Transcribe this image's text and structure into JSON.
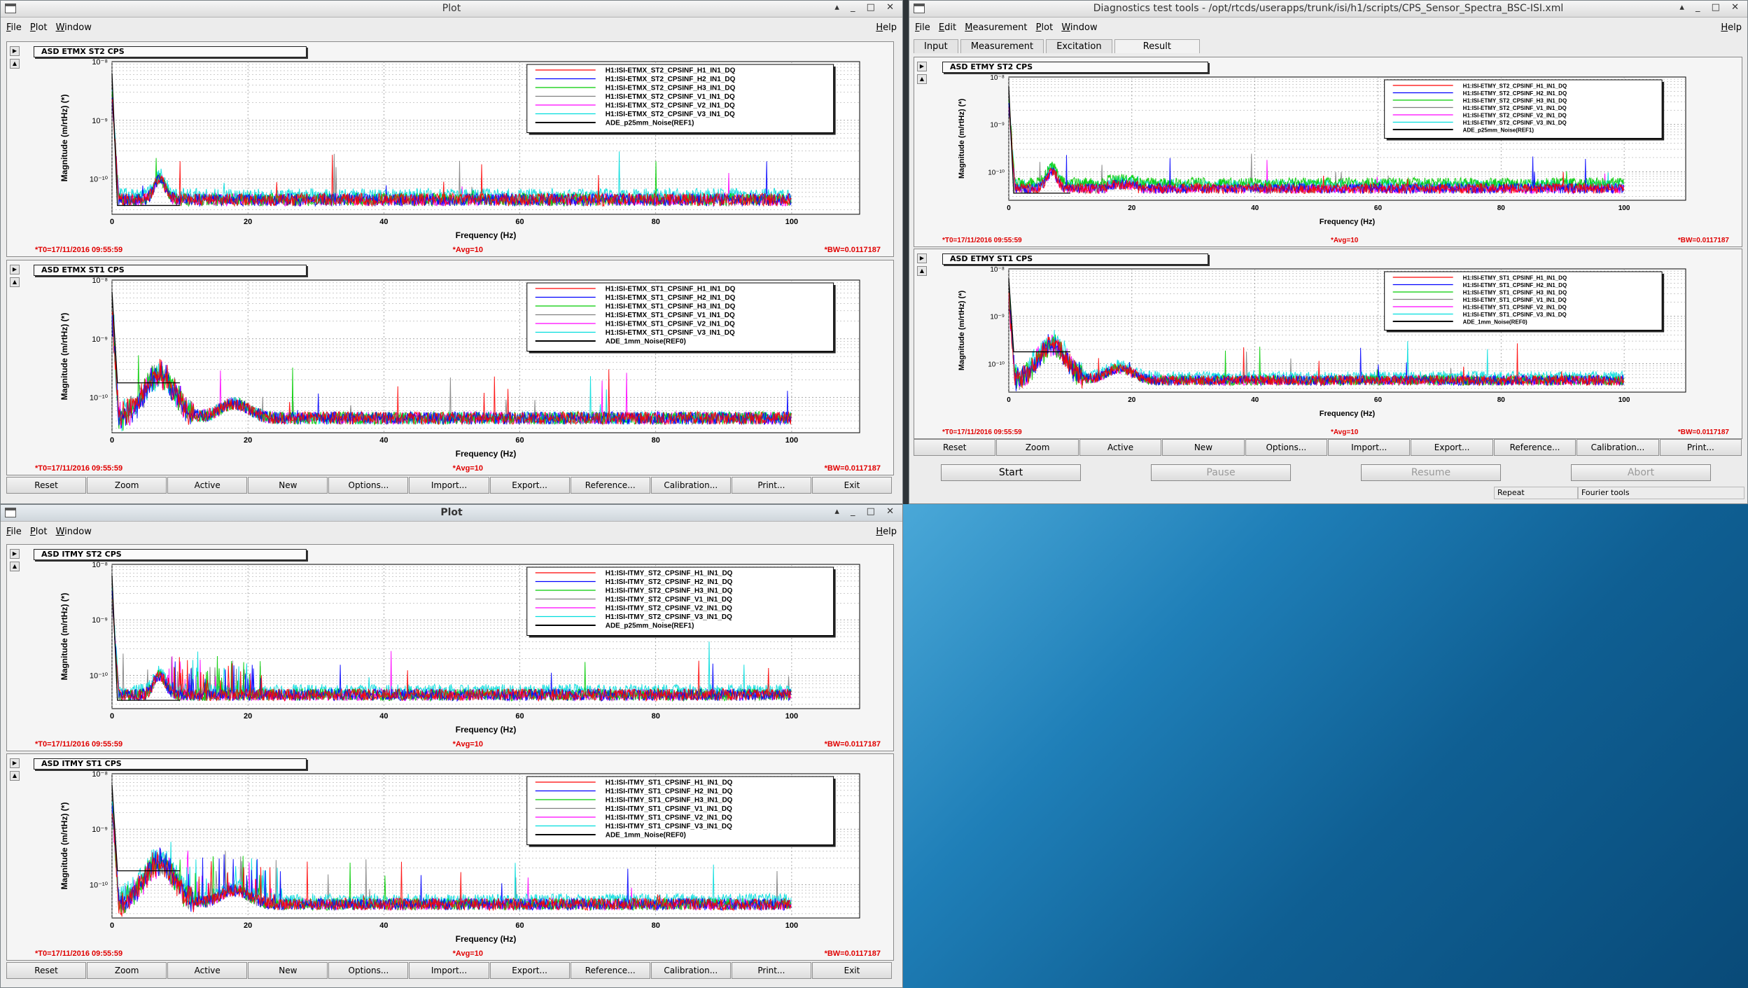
{
  "windows": {
    "plot_top": {
      "title": "Plot",
      "menu": [
        "File",
        "Plot",
        "Window"
      ],
      "help": "Help",
      "pads": [
        {
          "title": "ASD ETMX ST2 CPS",
          "legend": [
            "H1:ISI-ETMX_ST2_CPSINF_H1_IN1_DQ",
            "H1:ISI-ETMX_ST2_CPSINF_H2_IN1_DQ",
            "H1:ISI-ETMX_ST2_CPSINF_H3_IN1_DQ",
            "H1:ISI-ETMX_ST2_CPSINF_V1_IN1_DQ",
            "H1:ISI-ETMX_ST2_CPSINF_V2_IN1_DQ",
            "H1:ISI-ETMX_ST2_CPSINF_V3_IN1_DQ",
            "ADE_p25mm_Noise(REF1)"
          ],
          "shape": "st2"
        },
        {
          "title": "ASD ETMX ST1 CPS",
          "legend": [
            "H1:ISI-ETMX_ST1_CPSINF_H1_IN1_DQ",
            "H1:ISI-ETMX_ST1_CPSINF_H2_IN1_DQ",
            "H1:ISI-ETMX_ST1_CPSINF_H3_IN1_DQ",
            "H1:ISI-ETMX_ST1_CPSINF_V1_IN1_DQ",
            "H1:ISI-ETMX_ST1_CPSINF_V2_IN1_DQ",
            "H1:ISI-ETMX_ST1_CPSINF_V3_IN1_DQ",
            "ADE_1mm_Noise(REF0)"
          ],
          "shape": "st1"
        }
      ]
    },
    "plot_bottom": {
      "title": "Plot",
      "menu": [
        "File",
        "Plot",
        "Window"
      ],
      "help": "Help",
      "pads": [
        {
          "title": "ASD ITMY ST2 CPS",
          "legend": [
            "H1:ISI-ITMY_ST2_CPSINF_H1_IN1_DQ",
            "H1:ISI-ITMY_ST2_CPSINF_H2_IN1_DQ",
            "H1:ISI-ITMY_ST2_CPSINF_H3_IN1_DQ",
            "H1:ISI-ITMY_ST2_CPSINF_V1_IN1_DQ",
            "H1:ISI-ITMY_ST2_CPSINF_V2_IN1_DQ",
            "H1:ISI-ITMY_ST2_CPSINF_V3_IN1_DQ",
            "ADE_p25mm_Noise(REF1)"
          ],
          "shape": "st2b"
        },
        {
          "title": "ASD ITMY ST1 CPS",
          "legend": [
            "H1:ISI-ITMY_ST1_CPSINF_H1_IN1_DQ",
            "H1:ISI-ITMY_ST1_CPSINF_H2_IN1_DQ",
            "H1:ISI-ITMY_ST1_CPSINF_H3_IN1_DQ",
            "H1:ISI-ITMY_ST1_CPSINF_V1_IN1_DQ",
            "H1:ISI-ITMY_ST1_CPSINF_V2_IN1_DQ",
            "H1:ISI-ITMY_ST1_CPSINF_V3_IN1_DQ",
            "ADE_1mm_Noise(REF0)"
          ],
          "shape": "st1b"
        }
      ]
    },
    "dtt": {
      "title": "Diagnostics test tools - /opt/rtcds/userapps/trunk/isi/h1/scripts/CPS_Sensor_Spectra_BSC-ISI.xml",
      "menu": [
        "File",
        "Edit",
        "Measurement",
        "Plot",
        "Window"
      ],
      "help": "Help",
      "tabs": [
        "Input",
        "Measurement",
        "Excitation",
        "Result"
      ],
      "pads": [
        {
          "title": "ASD ETMY ST2 CPS",
          "legend": [
            "H1:ISI-ETMY_ST2_CPSINF_H1_IN1_DQ",
            "H1:ISI-ETMY_ST2_CPSINF_H2_IN1_DQ",
            "H1:ISI-ETMY_ST2_CPSINF_H3_IN1_DQ",
            "H1:ISI-ETMY_ST2_CPSINF_V1_IN1_DQ",
            "H1:ISI-ETMY_ST2_CPSINF_V2_IN1_DQ",
            "H1:ISI-ETMY_ST2_CPSINF_V3_IN1_DQ",
            "ADE_p25mm_Noise(REF1)"
          ],
          "shape": "st2c"
        },
        {
          "title": "ASD ETMY ST1 CPS",
          "legend": [
            "H1:ISI-ETMY_ST1_CPSINF_H1_IN1_DQ",
            "H1:ISI-ETMY_ST1_CPSINF_H2_IN1_DQ",
            "H1:ISI-ETMY_ST1_CPSINF_H3_IN1_DQ",
            "H1:ISI-ETMY_ST1_CPSINF_V1_IN1_DQ",
            "H1:ISI-ETMY_ST1_CPSINF_V2_IN1_DQ",
            "H1:ISI-ETMY_ST1_CPSINF_V3_IN1_DQ",
            "ADE_1mm_Noise(REF0)"
          ],
          "shape": "st1c"
        }
      ],
      "controls": {
        "start": "Start",
        "pause": "Pause",
        "resume": "Resume",
        "abort": "Abort"
      },
      "status": {
        "repeat": "Repeat",
        "fourier": "Fourier tools"
      }
    }
  },
  "axis": {
    "xlabel": "Frequency (Hz)",
    "ylabel": "Magnitude (m/rtHz) (*)",
    "xticks": [
      "0",
      "20",
      "40",
      "60",
      "80",
      "100"
    ],
    "yticks": [
      "10⁻⁸",
      "10⁻⁹",
      "10⁻¹⁰"
    ]
  },
  "footer": {
    "t0": "*T0=17/11/2016 09:55:59",
    "avg": "*Avg=10",
    "bw": "*BW=0.0117187"
  },
  "buttons": [
    "Reset",
    "Zoom",
    "Active",
    "New",
    "Options...",
    "Import...",
    "Export...",
    "Reference...",
    "Calibration...",
    "Print...",
    "Exit"
  ],
  "dtt_buttons": [
    "Reset",
    "Zoom",
    "Active",
    "New",
    "Options...",
    "Import...",
    "Export...",
    "Reference...",
    "Calibration...",
    "Print..."
  ],
  "series_colors": [
    "#ff0000",
    "#0000ff",
    "#00cc00",
    "#808080",
    "#ff00ff",
    "#00dddd",
    "#000000"
  ],
  "chart_data": [
    {
      "type": "line",
      "title": "ASD ETMX ST2 CPS",
      "xlabel": "Frequency (Hz)",
      "ylabel": "Magnitude (m/rtHz) (*)",
      "xlim": [
        0,
        110
      ],
      "ylim_log10": [
        -10.6,
        -8
      ],
      "yscale": "log"
    },
    {
      "type": "line",
      "title": "ASD ETMX ST1 CPS",
      "xlabel": "Frequency (Hz)",
      "ylabel": "Magnitude (m/rtHz) (*)",
      "xlim": [
        0,
        110
      ],
      "ylim_log10": [
        -10.6,
        -8
      ],
      "yscale": "log"
    },
    {
      "type": "line",
      "title": "ASD ITMY ST2 CPS",
      "xlabel": "Frequency (Hz)",
      "ylabel": "Magnitude (m/rtHz) (*)",
      "xlim": [
        0,
        110
      ],
      "ylim_log10": [
        -10.6,
        -8
      ],
      "yscale": "log"
    },
    {
      "type": "line",
      "title": "ASD ITMY ST1 CPS",
      "xlabel": "Frequency (Hz)",
      "ylabel": "Magnitude (m/rtHz) (*)",
      "xlim": [
        0,
        110
      ],
      "ylim_log10": [
        -10.6,
        -8
      ],
      "yscale": "log"
    },
    {
      "type": "line",
      "title": "ASD ETMY ST2 CPS",
      "xlabel": "Frequency (Hz)",
      "ylabel": "Magnitude (m/rtHz) (*)",
      "xlim": [
        0,
        110
      ],
      "ylim_log10": [
        -10.6,
        -8
      ],
      "yscale": "log"
    },
    {
      "type": "line",
      "title": "ASD ETMY ST1 CPS",
      "xlabel": "Frequency (Hz)",
      "ylabel": "Magnitude (m/rtHz) (*)",
      "xlim": [
        0,
        110
      ],
      "ylim_log10": [
        -10.6,
        -8
      ],
      "yscale": "log"
    }
  ]
}
